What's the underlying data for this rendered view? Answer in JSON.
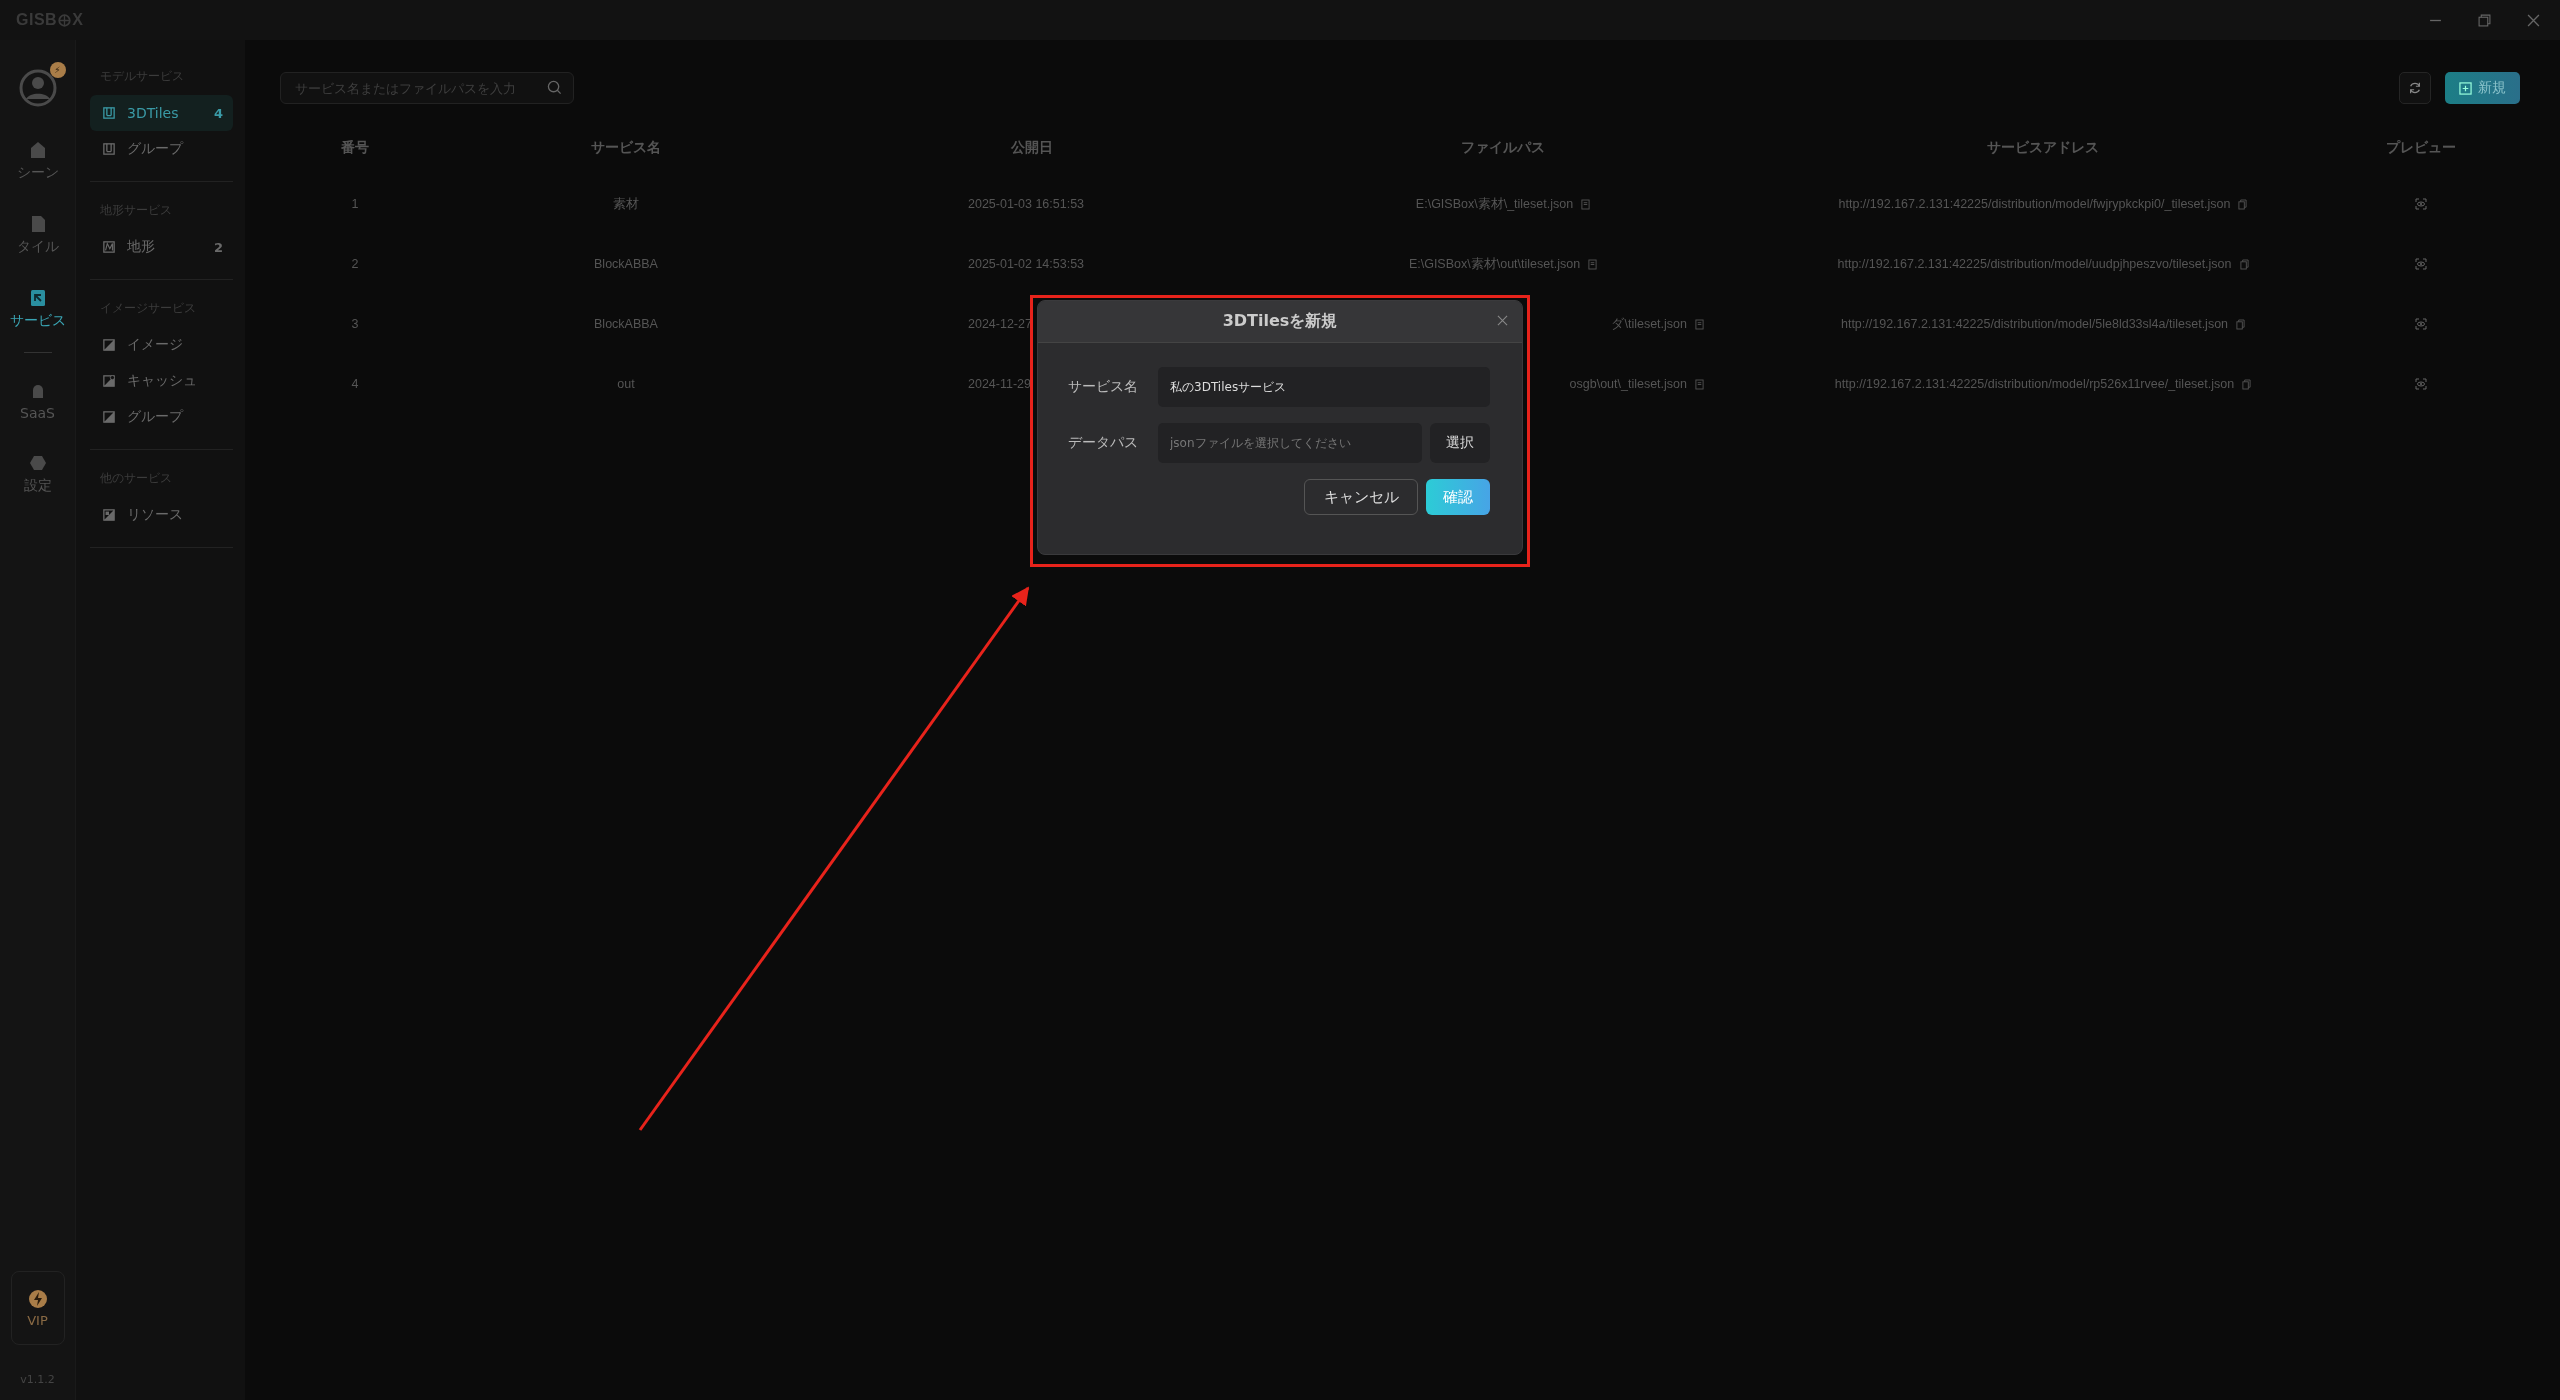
{
  "titlebar": {
    "logo_left": "GISB",
    "logo_right": "X"
  },
  "rail": {
    "badge": "⚡",
    "items": [
      {
        "kind": "scene",
        "label": "シーン",
        "selected": false
      },
      {
        "kind": "tile",
        "label": "タイル",
        "selected": false
      },
      {
        "kind": "service",
        "label": "サービス",
        "selected": true
      },
      {
        "kind": "divider"
      },
      {
        "kind": "saas",
        "label": "SaaS",
        "selected": false
      },
      {
        "kind": "settings",
        "label": "設定",
        "selected": false
      }
    ],
    "vip": {
      "label": "VIP"
    },
    "version": "v1.1.2"
  },
  "sections": [
    {
      "title": "モデルサービス",
      "items": [
        {
          "kind": "model",
          "label": "3DTiles",
          "count": "4",
          "selected": true
        },
        {
          "kind": "model",
          "label": "グループ",
          "selected": false
        }
      ]
    },
    {
      "title": "地形サービス",
      "items": [
        {
          "kind": "terrain",
          "label": "地形",
          "count": "2",
          "selected": false
        }
      ]
    },
    {
      "title": "イメージサービス",
      "items": [
        {
          "kind": "image",
          "label": "イメージ",
          "selected": false
        },
        {
          "kind": "cache",
          "label": "キャッシュ",
          "selected": false
        },
        {
          "kind": "group",
          "label": "グループ",
          "selected": false
        }
      ]
    },
    {
      "title": "他のサービス",
      "items": [
        {
          "kind": "resource",
          "label": "リソース",
          "selected": false
        }
      ]
    }
  ],
  "search": {
    "placeholder": "サービス名またはファイルパスを入力"
  },
  "new_button": "新規",
  "table": {
    "columns": [
      "番号",
      "サービス名",
      "公開日",
      "ファイルパス",
      "サービスアドレス",
      "プレビュー"
    ],
    "rows": [
      {
        "no": "1",
        "name": "素材",
        "date": "2025-01-03 16:51:53",
        "path": "E:\\GISBox\\素材\\_tileset.json",
        "address": "http://192.167.2.131:42225/distribution/model/fwjrypkckpi0/_tileset.json",
        "covered": false
      },
      {
        "no": "2",
        "name": "BlockABBA",
        "date": "2025-01-02 14:53:53",
        "path": "E:\\GISBox\\素材\\out\\tileset.json",
        "address": "http://192.167.2.131:42225/distribution/model/uudpjhpeszvo/tileset.json",
        "covered": false
      },
      {
        "no": "3",
        "name": "BlockABBA",
        "date": "2024-12-27",
        "path": "ダ\\tileset.json",
        "address": "http://192.167.2.131:42225/distribution/model/5le8ld33sl4a/tileset.json",
        "covered": true
      },
      {
        "no": "4",
        "name": "out",
        "date": "2024-11-29",
        "path": "osgb\\out\\_tileset.json",
        "address": "http://192.167.2.131:42225/distribution/model/rp526x11rvee/_tileset.json",
        "covered": true
      }
    ]
  },
  "dialog": {
    "title": "3DTilesを新規",
    "fields": [
      {
        "label": "サービス名",
        "value": "私の3DTilesサービス"
      },
      {
        "label": "データパス",
        "placeholder": "jsonファイルを選択してください",
        "button": "選択"
      }
    ],
    "buttons": [
      {
        "label": "キャンセル",
        "kind": "secondary"
      },
      {
        "label": "確認",
        "kind": "primary"
      }
    ]
  }
}
